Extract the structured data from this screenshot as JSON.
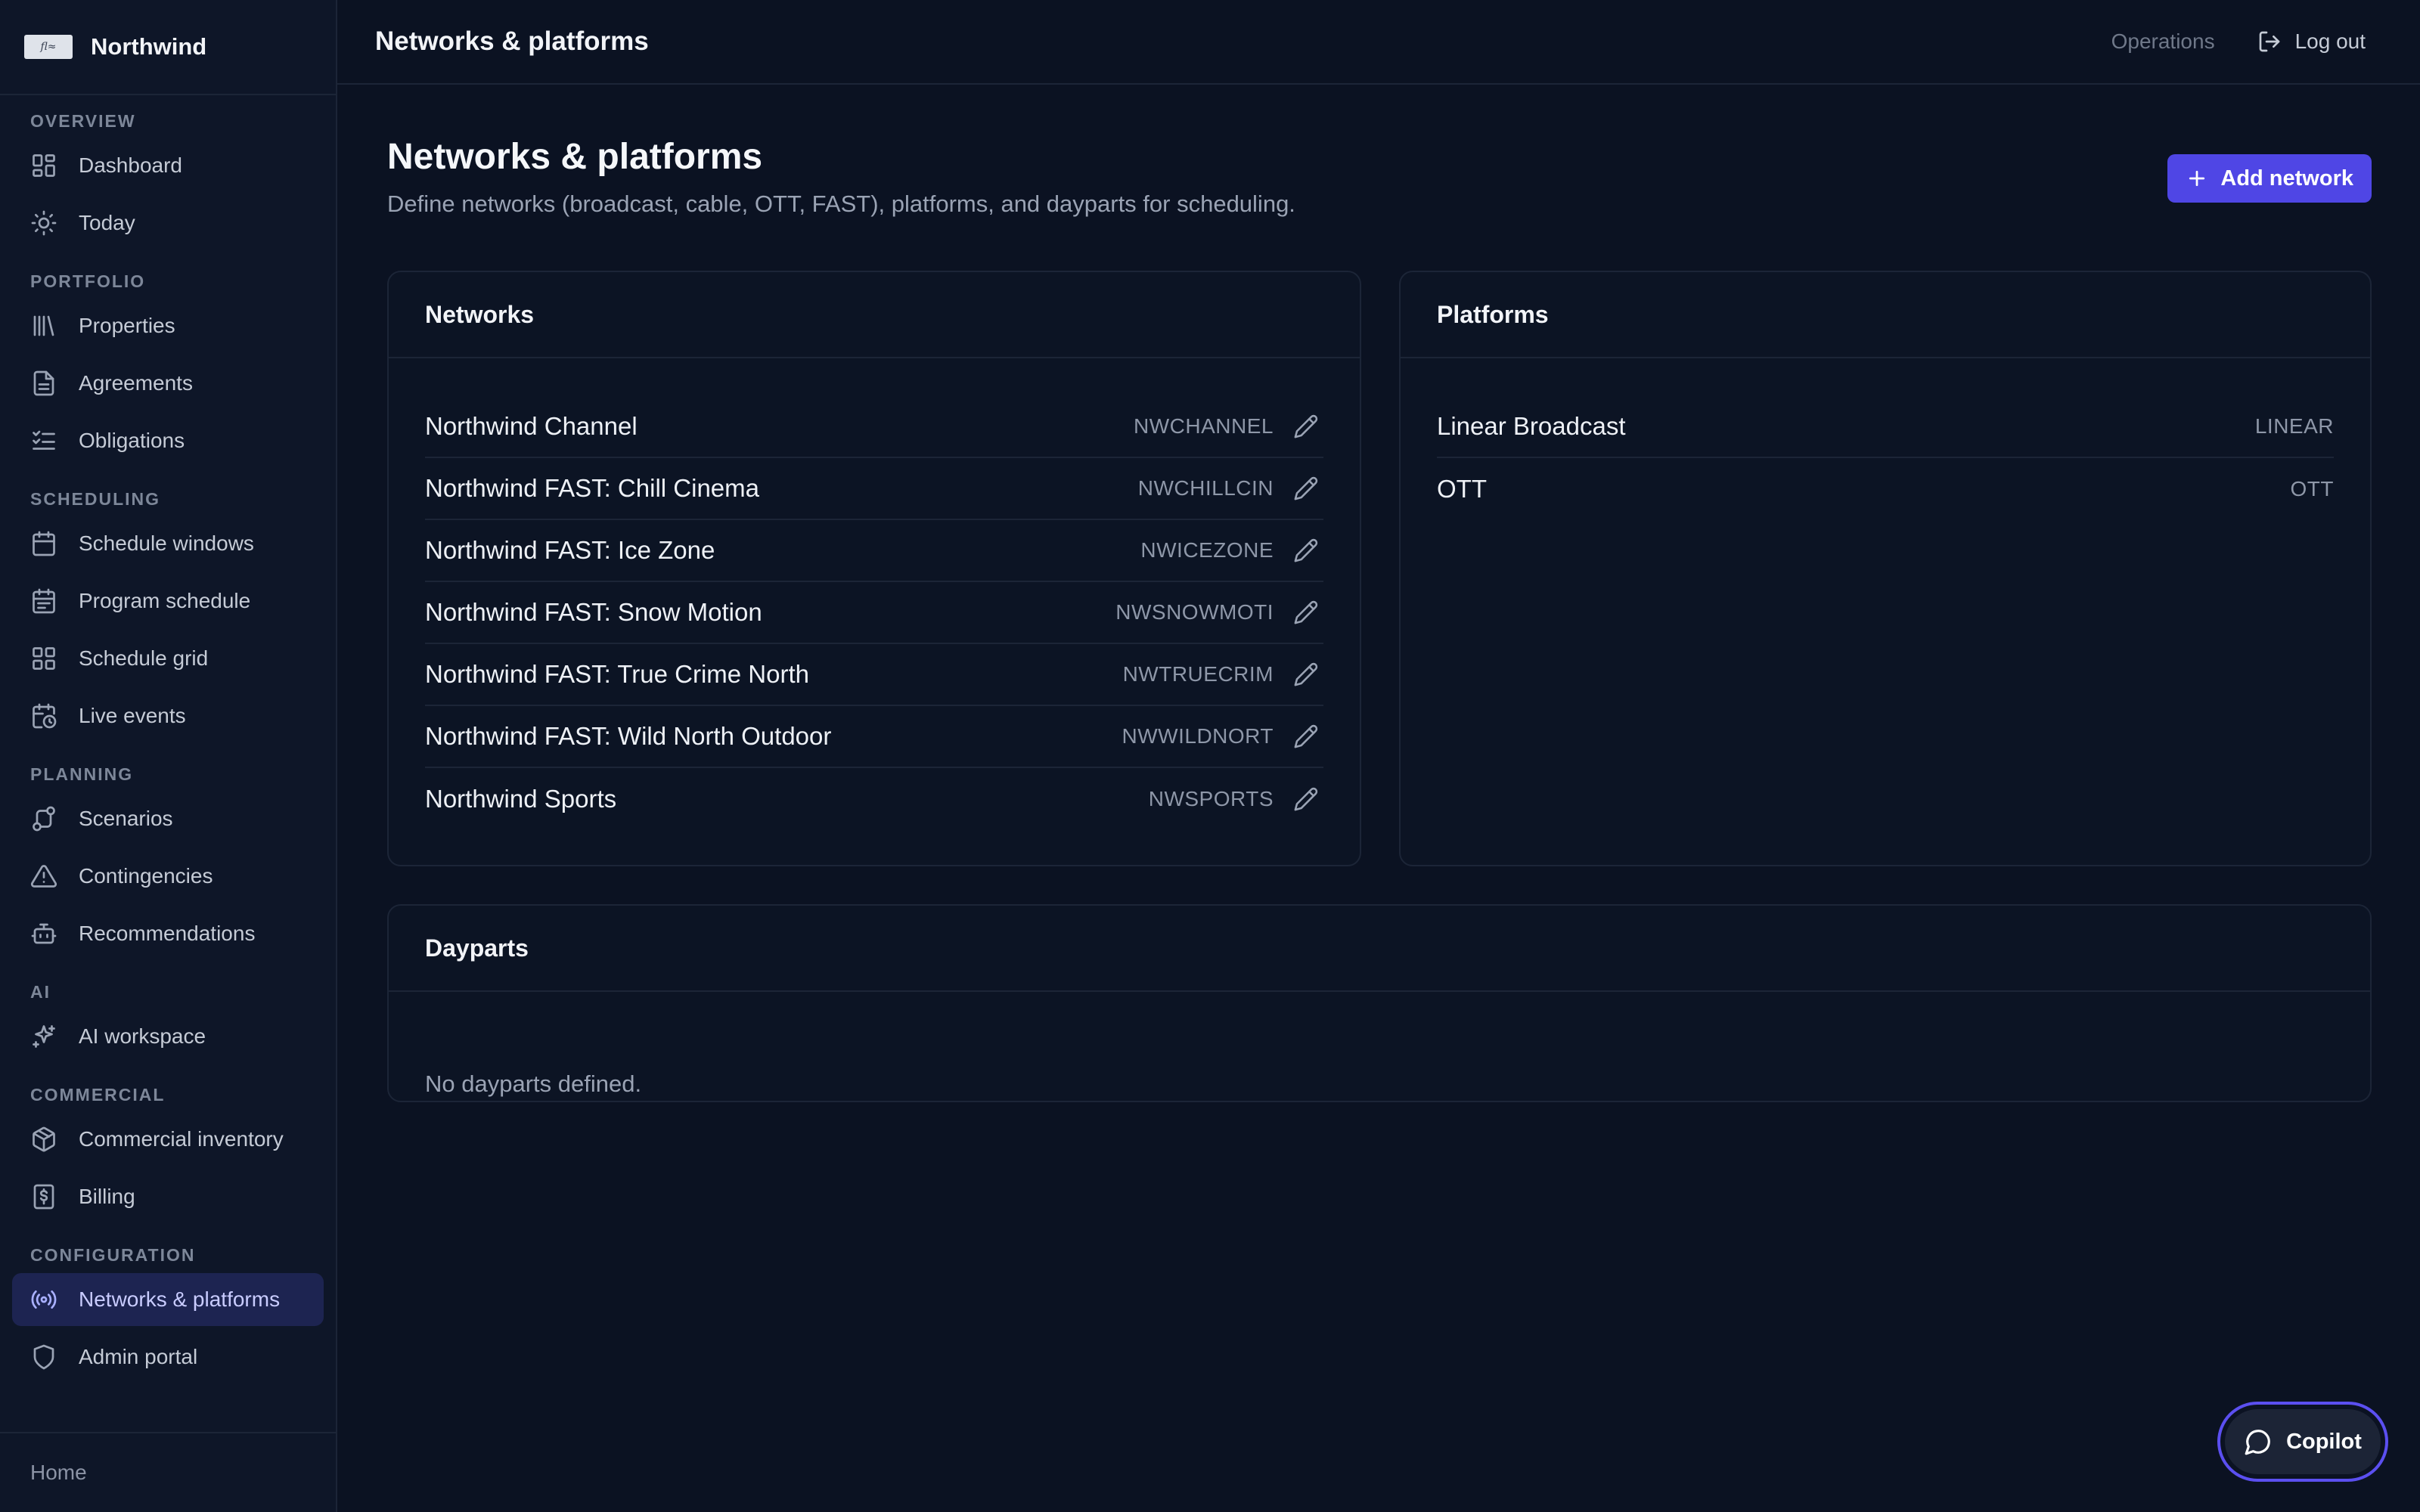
{
  "brand": {
    "name": "Northwind",
    "logo_text": "fl≈"
  },
  "sidebar": {
    "sections": [
      {
        "title": "OVERVIEW",
        "items": [
          {
            "label": "Dashboard",
            "icon": "dashboard-icon"
          },
          {
            "label": "Today",
            "icon": "sun-icon"
          }
        ]
      },
      {
        "title": "PORTFOLIO",
        "items": [
          {
            "label": "Properties",
            "icon": "library-icon"
          },
          {
            "label": "Agreements",
            "icon": "document-icon"
          },
          {
            "label": "Obligations",
            "icon": "checklist-icon"
          }
        ]
      },
      {
        "title": "SCHEDULING",
        "items": [
          {
            "label": "Schedule windows",
            "icon": "calendar-icon"
          },
          {
            "label": "Program schedule",
            "icon": "calendar-list-icon"
          },
          {
            "label": "Schedule grid",
            "icon": "grid-icon"
          },
          {
            "label": "Live events",
            "icon": "calendar-clock-icon"
          }
        ]
      },
      {
        "title": "PLANNING",
        "items": [
          {
            "label": "Scenarios",
            "icon": "route-icon"
          },
          {
            "label": "Contingencies",
            "icon": "warning-icon"
          },
          {
            "label": "Recommendations",
            "icon": "bot-icon"
          }
        ]
      },
      {
        "title": "AI",
        "items": [
          {
            "label": "AI workspace",
            "icon": "sparkles-icon"
          }
        ]
      },
      {
        "title": "COMMERCIAL",
        "items": [
          {
            "label": "Commercial inventory",
            "icon": "package-icon"
          },
          {
            "label": "Billing",
            "icon": "receipt-dollar-icon"
          }
        ]
      },
      {
        "title": "CONFIGURATION",
        "items": [
          {
            "label": "Networks & platforms",
            "icon": "broadcast-icon",
            "active": true
          },
          {
            "label": "Admin portal",
            "icon": "shield-icon"
          }
        ]
      }
    ],
    "footer": "Home"
  },
  "topbar": {
    "title": "Networks & platforms",
    "context": "Operations",
    "logout": "Log out"
  },
  "page": {
    "title": "Networks & platforms",
    "subtitle": "Define networks (broadcast, cable, OTT, FAST), platforms, and dayparts for scheduling.",
    "add_button": "Add network"
  },
  "networks": {
    "title": "Networks",
    "rows": [
      {
        "name": "Northwind Channel",
        "code": "NWCHANNEL"
      },
      {
        "name": "Northwind FAST: Chill Cinema",
        "code": "NWCHILLCIN"
      },
      {
        "name": "Northwind FAST: Ice Zone",
        "code": "NWICEZONE"
      },
      {
        "name": "Northwind FAST: Snow Motion",
        "code": "NWSNOWMOTI"
      },
      {
        "name": "Northwind FAST: True Crime North",
        "code": "NWTRUECRIM"
      },
      {
        "name": "Northwind FAST: Wild North Outdoor",
        "code": "NWWILDNORT"
      },
      {
        "name": "Northwind Sports",
        "code": "NWSPORTS"
      }
    ]
  },
  "platforms": {
    "title": "Platforms",
    "rows": [
      {
        "name": "Linear Broadcast",
        "code": "LINEAR"
      },
      {
        "name": "OTT",
        "code": "OTT"
      }
    ]
  },
  "dayparts": {
    "title": "Dayparts",
    "empty": "No dayparts defined."
  },
  "copilot": {
    "label": "Copilot"
  },
  "colors": {
    "accent": "#4f46e5",
    "background": "#0b1222",
    "sidebar": "#0e1628",
    "active_nav": "#1d2451"
  }
}
